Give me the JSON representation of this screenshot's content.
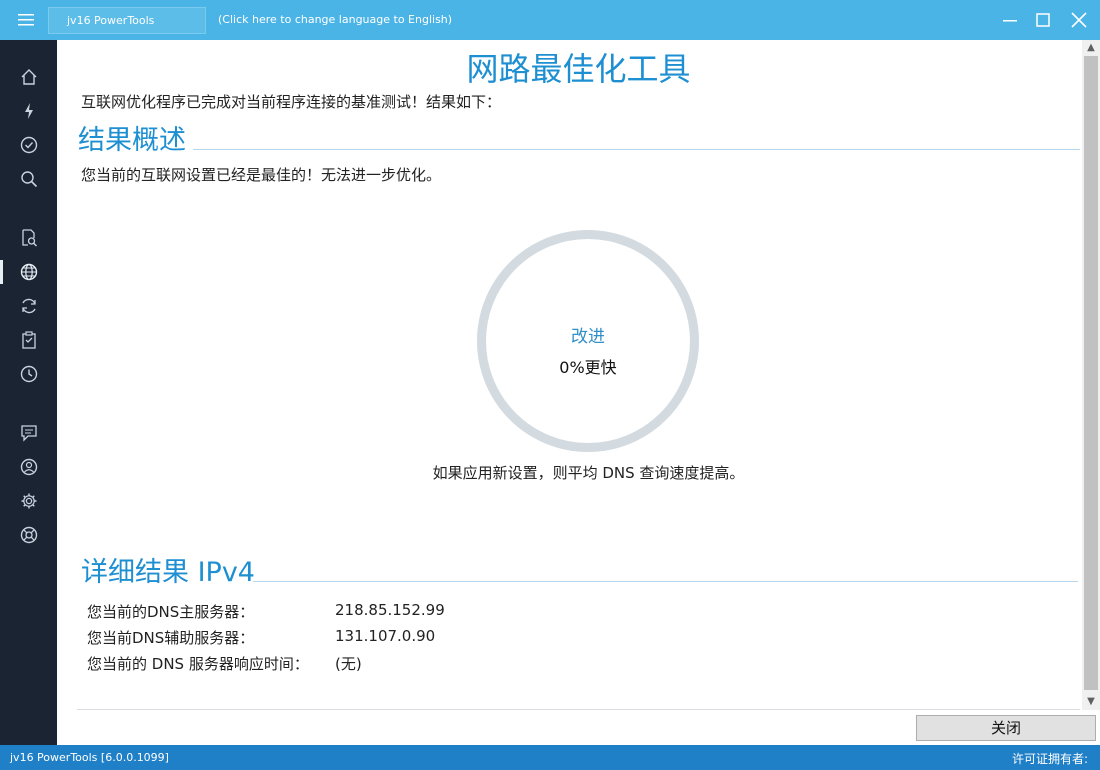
{
  "titlebar": {
    "app_tab": "jv16 PowerTools",
    "language_link": "(Click here to change language to English)"
  },
  "page": {
    "title": "网路最佳化工具",
    "intro": "互联网优化程序已完成对当前程序连接的基准测试！结果如下：",
    "summary_heading": "结果概述",
    "summary_status": "您当前的互联网设置已经是最佳的！无法进一步优化。",
    "ring_label": "改进",
    "ring_value": "0%更快",
    "explain": "如果应用新设置，则平均 DNS 查询速度提高。",
    "improvement_percent": 0
  },
  "details": {
    "heading": "详细结果 IPv4",
    "rows": [
      {
        "label": "您当前的DNS主服务器：",
        "value": "218.85.152.99"
      },
      {
        "label": "您当前DNS辅助服务器：",
        "value": "131.107.0.90"
      },
      {
        "label": "您当前的 DNS 服务器响应时间：",
        "value": "(无)"
      }
    ]
  },
  "buttons": {
    "close": "关闭"
  },
  "statusbar": {
    "version": "jv16 PowerTools [6.0.0.1099]",
    "license": "许可证拥有者:"
  },
  "sidebar": {
    "icons": [
      "home-icon",
      "lightning-icon",
      "check-circle-icon",
      "search-icon",
      "file-search-icon",
      "globe-icon",
      "refresh-icon",
      "clipboard-icon",
      "clock-icon",
      "message-icon",
      "user-circle-icon",
      "gear-icon",
      "lifebuoy-icon"
    ],
    "active": "globe-icon"
  },
  "colors": {
    "accent": "#1e8fd1",
    "titlebar": "#4bb4e6",
    "sidebar": "#1a2433",
    "statusbar": "#1f7fc7"
  }
}
